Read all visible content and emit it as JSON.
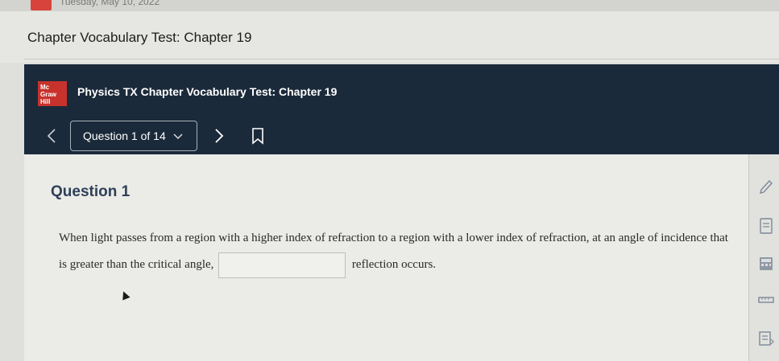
{
  "browser": {
    "date_text": "Tuesday, May 10, 2022"
  },
  "page": {
    "title": "Chapter Vocabulary Test: Chapter 19"
  },
  "app_bar": {
    "logo_lines": [
      "Mc",
      "Graw",
      "Hill"
    ],
    "title": "Physics TX Chapter Vocabulary Test: Chapter 19",
    "question_selector": "Question 1 of 14"
  },
  "question": {
    "heading": "Question 1",
    "text_before": "When light passes from a region with a higher index of refraction to a region with a lower index of refraction, at an angle of incidence that is greater than the critical angle,",
    "answer_value": "",
    "text_after": "reflection occurs."
  },
  "icons": {
    "prev": "chevron-left-icon",
    "next": "chevron-right-icon",
    "bookmark": "bookmark-icon",
    "side_tools": [
      "pencil-icon",
      "notes-icon",
      "calculator-icon",
      "ruler-icon",
      "reference-icon"
    ]
  }
}
